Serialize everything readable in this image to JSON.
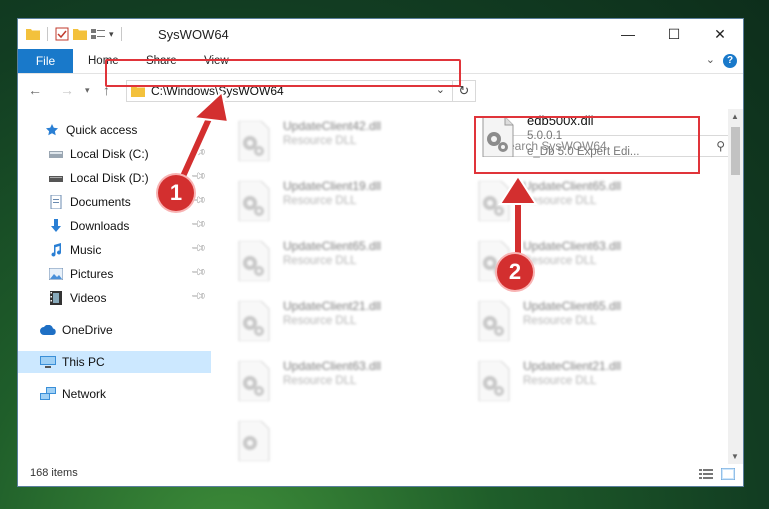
{
  "window": {
    "title": "SysWOW64"
  },
  "ribbon": {
    "tabs": [
      "File",
      "Home",
      "Share",
      "View"
    ],
    "help": "?"
  },
  "navigation": {
    "address_path": "C:\\Windows\\SysWOW64",
    "search_placeholder": "Search SysWOW64"
  },
  "sidebar": {
    "quick_access": "Quick access",
    "items": [
      {
        "label": "Local Disk (C:)",
        "icon": "drive-icon",
        "pinned": true
      },
      {
        "label": "Local Disk (D:)",
        "icon": "drive-icon",
        "pinned": true
      },
      {
        "label": "Documents",
        "icon": "documents-icon",
        "pinned": true
      },
      {
        "label": "Downloads",
        "icon": "downloads-icon",
        "pinned": true
      },
      {
        "label": "Music",
        "icon": "music-icon",
        "pinned": true
      },
      {
        "label": "Pictures",
        "icon": "pictures-icon",
        "pinned": true
      },
      {
        "label": "Videos",
        "icon": "videos-icon",
        "pinned": true
      }
    ],
    "onedrive": "OneDrive",
    "this_pc": "This PC",
    "network": "Network"
  },
  "files": {
    "highlighted": {
      "name": "edb500x.dll",
      "version": "5.0.0.1",
      "description": "e_Db 5.0 Expert Edi..."
    },
    "blurred": [
      {
        "name": "UpdateClient42.dll",
        "type": "Resource DLL"
      },
      {
        "name": "UpdateClient19.dll",
        "type": "Resource DLL"
      },
      {
        "name": "UpdateClient65.dll",
        "type": "Resource DLL"
      },
      {
        "name": "UpdateClient65.dll",
        "type": "Resource DLL"
      },
      {
        "name": "UpdateClient63.dll",
        "type": "Resource DLL"
      },
      {
        "name": "UpdateClient21.dll",
        "type": "Resource DLL"
      },
      {
        "name": "UpdateClient65.dll",
        "type": "Resource DLL"
      },
      {
        "name": "UpdateClient63.dll",
        "type": "Resource DLL"
      },
      {
        "name": "UpdateClient21.dll",
        "type": "Resource DLL"
      }
    ]
  },
  "status": {
    "item_count": "168 items"
  },
  "annotations": {
    "badge1": "1",
    "badge2": "2"
  },
  "colors": {
    "accent": "#1979ca",
    "highlight": "#e0343a",
    "selected": "#cce8ff"
  }
}
